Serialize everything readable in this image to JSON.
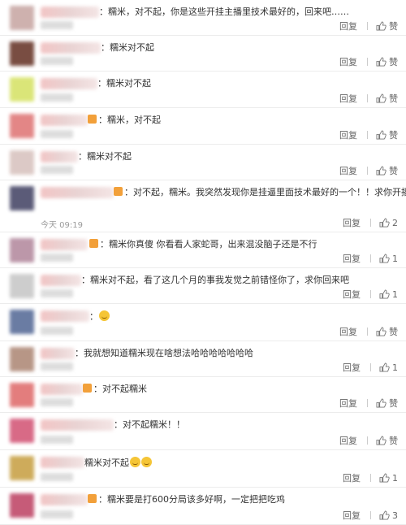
{
  "comments": [
    {
      "text": "：糯米，对不起，你是这些开挂主播里技术最好的，回来吧……",
      "reply": "回复",
      "like": "赞",
      "time": "",
      "emoji": 0
    },
    {
      "text": "：糯米对不起",
      "reply": "回复",
      "like": "赞",
      "time": "",
      "emoji": 0
    },
    {
      "text": "：糯米对不起",
      "reply": "回复",
      "like": "赞",
      "time": "",
      "emoji": 0
    },
    {
      "text": "：糯米，对不起",
      "reply": "回复",
      "like": "赞",
      "time": "",
      "emoji": 0
    },
    {
      "text": "：糯米对不起",
      "reply": "回复",
      "like": "赞",
      "time": "",
      "emoji": 0
    },
    {
      "text": "：对不起，糯米。我突然发现你是挂逼里面技术最好的一个！！求你开播",
      "reply": "回复",
      "like": "2",
      "time": "今天 09:19",
      "emoji": 0
    },
    {
      "text": "：糯米你真傻 你看看人家蛇哥，出来混没脑子还是不行",
      "reply": "回复",
      "like": "1",
      "time": "",
      "emoji": 0
    },
    {
      "text": "：糯米对不起，看了这几个月的事我发觉之前错怪你了，求你回来吧",
      "reply": "回复",
      "like": "1",
      "time": "",
      "emoji": 0
    },
    {
      "text": "：",
      "reply": "回复",
      "like": "赞",
      "time": "",
      "emoji": 1
    },
    {
      "text": "：我就想知道糯米现在啥想法哈哈哈哈哈哈哈",
      "reply": "回复",
      "like": "1",
      "time": "",
      "emoji": 0
    },
    {
      "text": "：对不起糯米",
      "reply": "回复",
      "like": "赞",
      "time": "",
      "emoji": 0
    },
    {
      "text": "：对不起糯米！！",
      "reply": "回复",
      "like": "赞",
      "time": "",
      "emoji": 0
    },
    {
      "text": "糯米对不起",
      "reply": "回复",
      "like": "1",
      "time": "",
      "emoji": 2
    },
    {
      "text": "：糯米要是打600分局该多好啊，一定把把吃鸡",
      "reply": "回复",
      "like": "3",
      "time": "",
      "emoji": 0
    }
  ],
  "colors": {
    "accent": "#f2a03a",
    "link": "#666666"
  },
  "icons": {
    "like": "thumbs-up-icon",
    "badge": "member-badge-icon",
    "emoji": "smiley-icon"
  }
}
